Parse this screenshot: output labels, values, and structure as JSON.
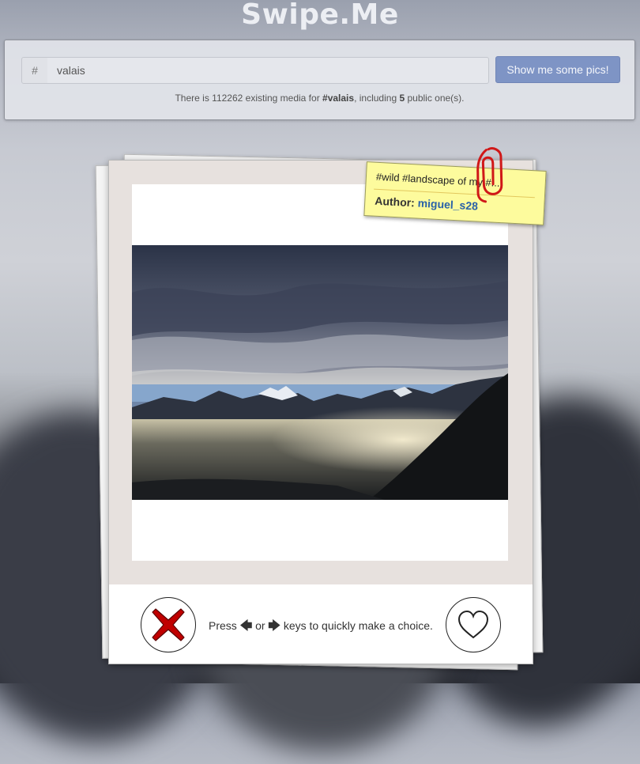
{
  "app": {
    "title": "Swipe.Me"
  },
  "search": {
    "prefix": "#",
    "value": "valais",
    "button_label": "Show me some pics!"
  },
  "info": {
    "prefix": "There is ",
    "media_count": "112262",
    "middle": " existing media for ",
    "tag": "#valais",
    "including": ", including ",
    "public_count": "5",
    "suffix": " public one(s)."
  },
  "card": {
    "tags": "#wild #landscape of my #...",
    "author_label": "Author:",
    "author_name": "miguel_s28"
  },
  "controls": {
    "hint_press": "Press",
    "left_arrow": "🡄",
    "or": "or",
    "right_arrow": "🡆",
    "hint_tail": "keys to quickly make a choice."
  },
  "colors": {
    "accent": "#7e94c5",
    "note": "#fdfb9d",
    "dislike": "#c00000"
  }
}
